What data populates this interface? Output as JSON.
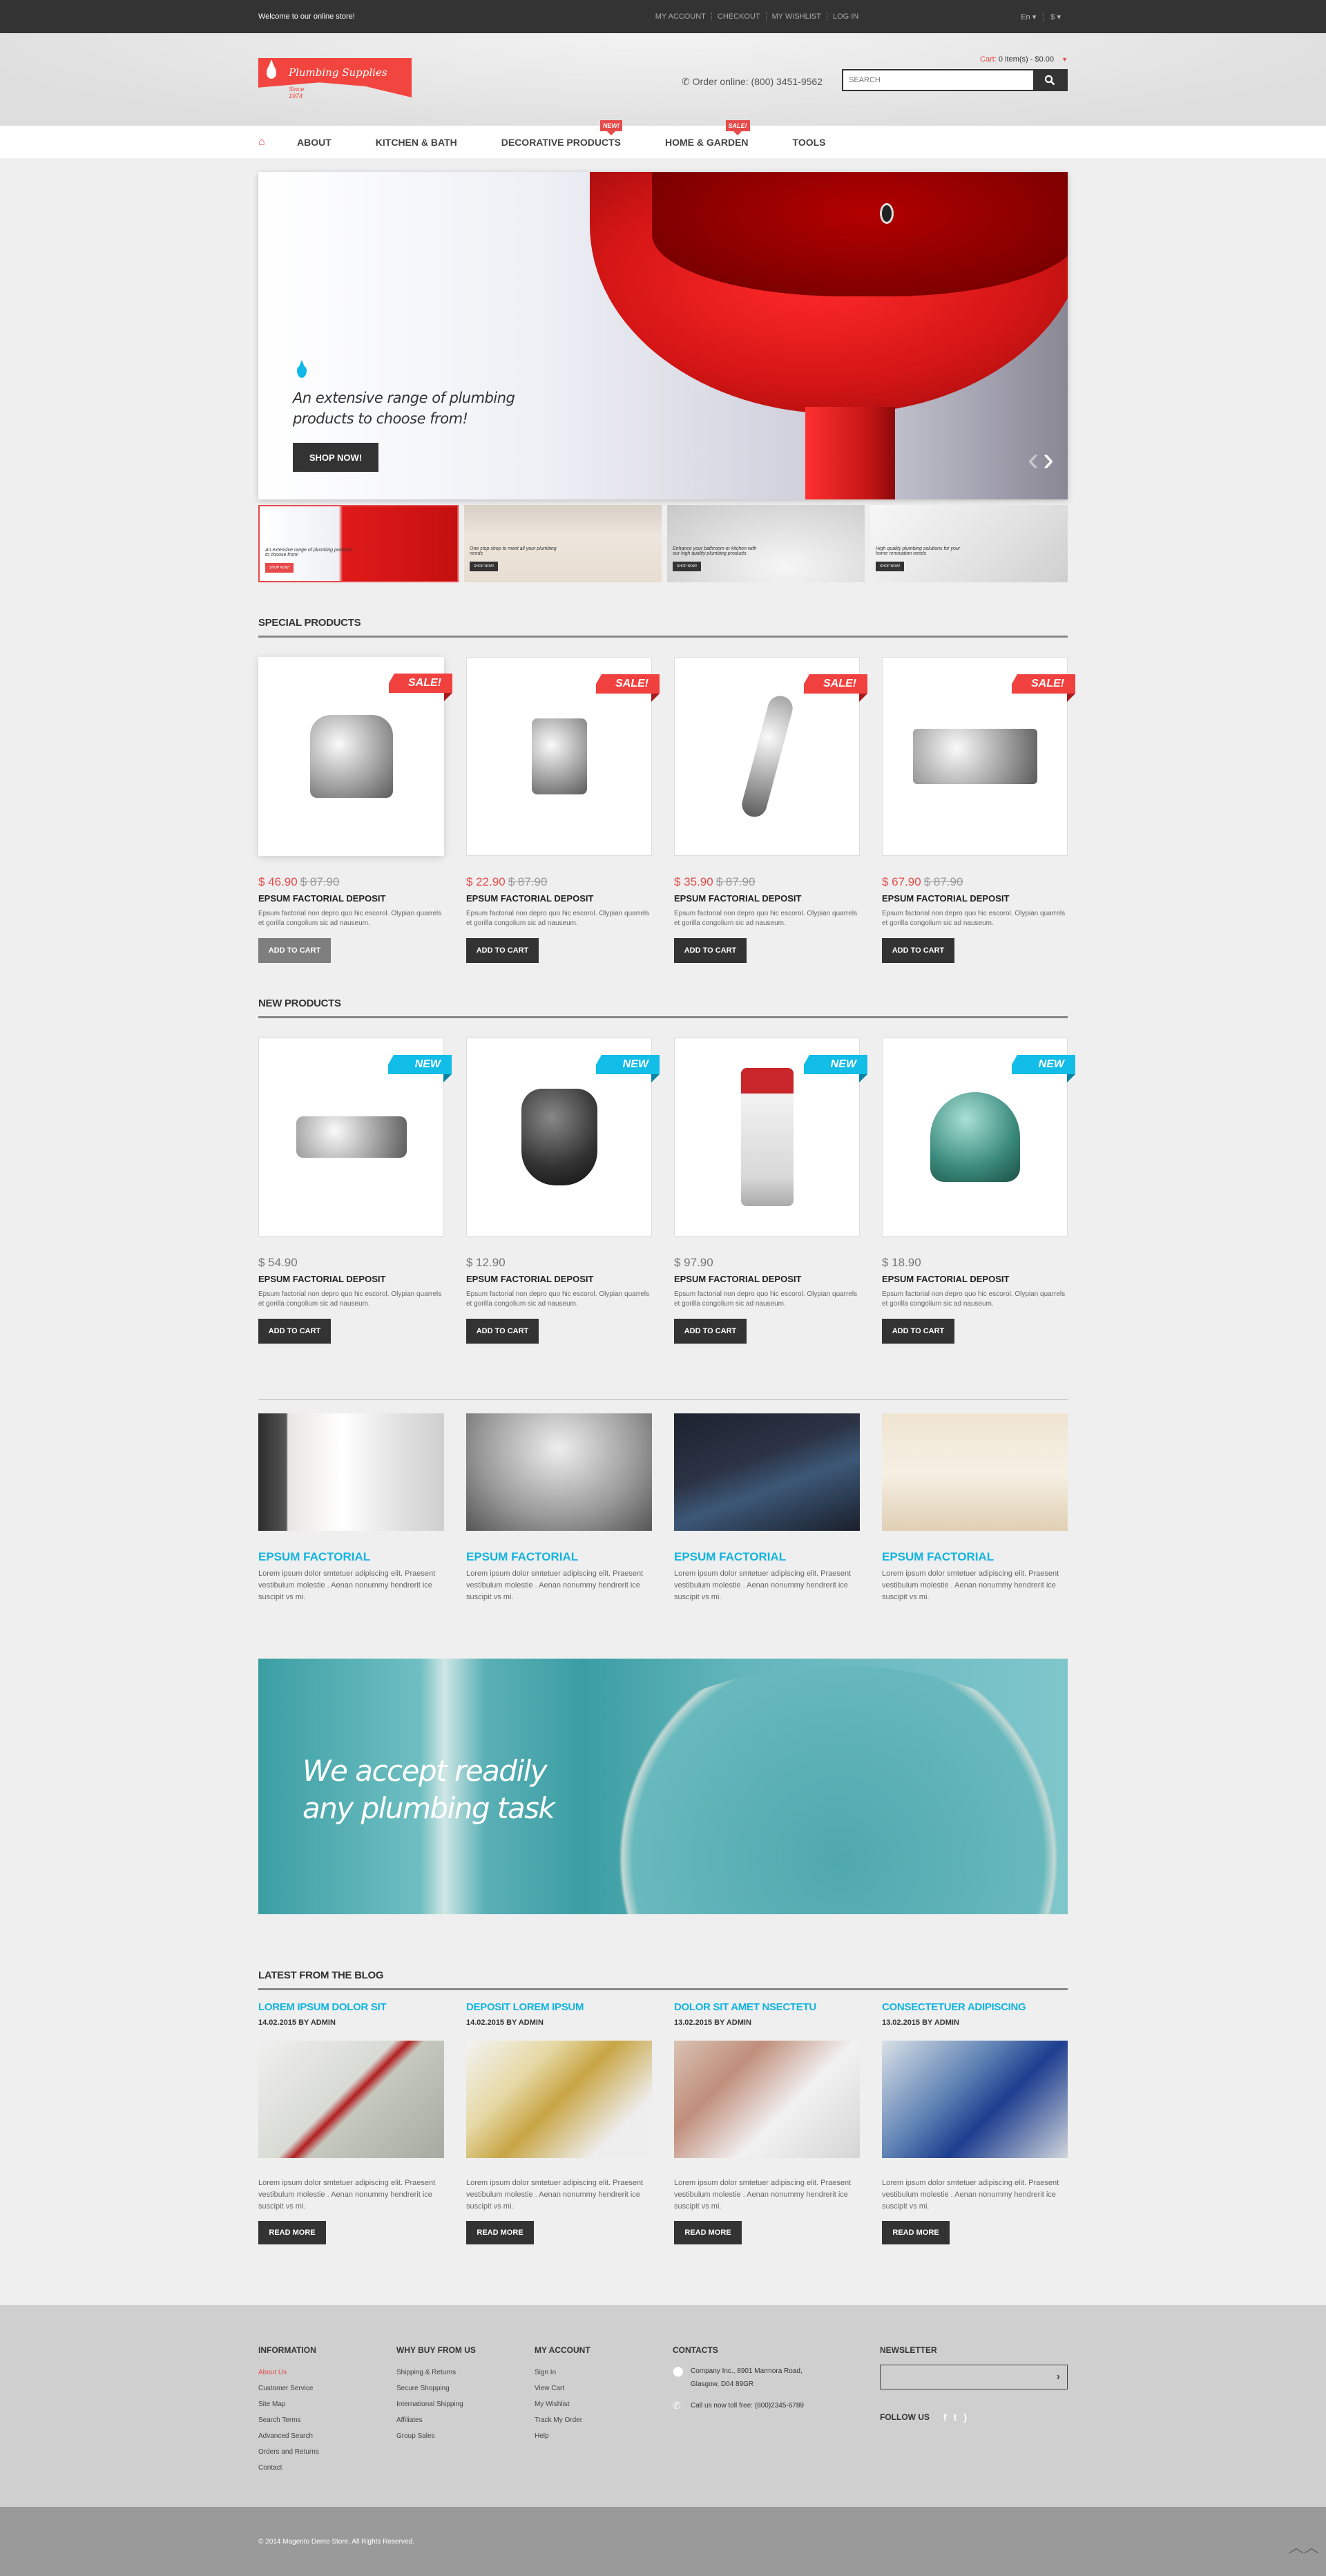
{
  "topbar": {
    "welcome": "Welcome to our online store!",
    "links": [
      "MY ACCOUNT",
      "CHECKOUT",
      "MY WISHLIST",
      "LOG IN"
    ],
    "language": "En",
    "currency": "$"
  },
  "header": {
    "logo_title": "Plumbing Supplies",
    "logo_since": "Since 1974",
    "cart_label": "Cart:",
    "cart_value": "0 item(s) - $0.00",
    "order_online": "Order online: (800) 3451-9562",
    "search_placeholder": "SEARCH"
  },
  "nav": {
    "items": [
      {
        "label": "ABOUT",
        "badge": ""
      },
      {
        "label": "KITCHEN & BATH",
        "badge": ""
      },
      {
        "label": "DECORATIVE PRODUCTS",
        "badge": "NEW!"
      },
      {
        "label": "HOME & GARDEN",
        "badge": "SALE!"
      },
      {
        "label": "TOOLS",
        "badge": ""
      }
    ]
  },
  "slider": {
    "caption": "An extensive range of plumbing products to choose from!",
    "button": "SHOP NOW!",
    "thumbs": [
      {
        "caption": "An extensive range of plumbing products to choose from!",
        "button": "SHOP NOW!"
      },
      {
        "caption": "One stop shop to meet all your plumbing needs",
        "button": "SHOP NOW!"
      },
      {
        "caption": "Enhance your bathroom or kitchen with our high quality plumbing products",
        "button": "SHOP NOW!"
      },
      {
        "caption": "High quality plumbing solutions for your home renovation needs",
        "button": "SHOP NOW!"
      }
    ]
  },
  "special": {
    "title": "SPECIAL PRODUCTS",
    "badge": "SALE!",
    "items": [
      {
        "price": "$ 46.90",
        "old_price": "$ 87.90",
        "name": "EPSUM FACTORIAL DEPOSIT",
        "desc": "Epsum factorial non depro quo hic escorol. Olypian quarrels et gorilla congolium sic ad nauseum.",
        "button": "ADD TO CART"
      },
      {
        "price": "$ 22.90",
        "old_price": "$ 87.90",
        "name": "EPSUM FACTORIAL DEPOSIT",
        "desc": "Epsum factorial non depro quo hic escorol. Olypian quarrels et gorilla congolium sic ad nauseum.",
        "button": "ADD TO CART"
      },
      {
        "price": "$ 35.90",
        "old_price": "$ 87.90",
        "name": "EPSUM FACTORIAL DEPOSIT",
        "desc": "Epsum factorial non depro quo hic escorol. Olypian quarrels et gorilla congolium sic ad nauseum.",
        "button": "ADD TO CART"
      },
      {
        "price": "$ 67.90",
        "old_price": "$ 87.90",
        "name": "EPSUM FACTORIAL DEPOSIT",
        "desc": "Epsum factorial non depro quo hic escorol. Olypian quarrels et gorilla congolium sic ad nauseum.",
        "button": "ADD TO CART"
      }
    ]
  },
  "new_products": {
    "title": "NEW PRODUCTS",
    "badge": "NEW",
    "items": [
      {
        "price": "$ 54.90",
        "name": "EPSUM FACTORIAL DEPOSIT",
        "desc": "Epsum factorial non depro quo hic escorol. Olypian quarrels et gorilla congolium sic ad nauseum.",
        "button": "ADD TO CART"
      },
      {
        "price": "$ 12.90",
        "name": "EPSUM FACTORIAL DEPOSIT",
        "desc": "Epsum factorial non depro quo hic escorol. Olypian quarrels et gorilla congolium sic ad nauseum.",
        "button": "ADD TO CART"
      },
      {
        "price": "$ 97.90",
        "name": "EPSUM FACTORIAL DEPOSIT",
        "desc": "Epsum factorial non depro quo hic escorol. Olypian quarrels et gorilla congolium sic ad nauseum.",
        "button": "ADD TO CART"
      },
      {
        "price": "$ 18.90",
        "name": "EPSUM FACTORIAL DEPOSIT",
        "desc": "Epsum factorial non depro quo hic escorol. Olypian quarrels et gorilla congolium sic ad nauseum.",
        "button": "ADD TO CART"
      }
    ]
  },
  "features": [
    {
      "title": "EPSUM FACTORIAL",
      "desc": "Lorem ipsum dolor smtetuer adipiscing elit. Praesent vestibulum molestie . Aenan nonummy hendrerit ice suscipit vs mi."
    },
    {
      "title": "EPSUM FACTORIAL",
      "desc": "Lorem ipsum dolor smtetuer adipiscing elit. Praesent vestibulum molestie . Aenan nonummy hendrerit ice suscipit vs mi."
    },
    {
      "title": "EPSUM FACTORIAL",
      "desc": "Lorem ipsum dolor smtetuer adipiscing elit. Praesent vestibulum molestie . Aenan nonummy hendrerit ice suscipit vs mi."
    },
    {
      "title": "EPSUM FACTORIAL",
      "desc": "Lorem ipsum dolor smtetuer adipiscing elit. Praesent vestibulum molestie . Aenan nonummy hendrerit ice suscipit vs mi."
    }
  ],
  "banner": {
    "line1": "We accept readily",
    "line2": "any plumbing task"
  },
  "blog": {
    "title": "LATEST FROM THE BLOG",
    "posts": [
      {
        "title": "LOREM IPSUM DOLOR SIT",
        "meta": "14.02.2015 BY ADMIN",
        "desc": "Lorem ipsum dolor smtetuer adipiscing elit. Praesent vestibulum molestie . Aenan nonummy hendrerit ice suscipit vs mi.",
        "button": "READ MORE"
      },
      {
        "title": "DEPOSIT LOREM IPSUM",
        "meta": "14.02.2015 BY ADMIN",
        "desc": "Lorem ipsum dolor smtetuer adipiscing elit. Praesent vestibulum molestie . Aenan nonummy hendrerit ice suscipit vs mi.",
        "button": "READ MORE"
      },
      {
        "title": "DOLOR SIT AMET NSECTETU",
        "meta": "13.02.2015 BY ADMIN",
        "desc": "Lorem ipsum dolor smtetuer adipiscing elit. Praesent vestibulum molestie . Aenan nonummy hendrerit ice suscipit vs mi.",
        "button": "READ MORE"
      },
      {
        "title": "CONSECTETUER ADIPISCING",
        "meta": "13.02.2015 BY ADMIN",
        "desc": "Lorem ipsum dolor smtetuer adipiscing elit. Praesent vestibulum molestie . Aenan nonummy hendrerit ice suscipit vs mi.",
        "button": "READ MORE"
      }
    ]
  },
  "footer": {
    "information": {
      "title": "INFORMATION",
      "links": [
        "About Us",
        "Customer Service",
        "Site Map",
        "Search Terms",
        "Advanced Search",
        "Orders and Returns",
        "Contact"
      ]
    },
    "why_buy": {
      "title": "WHY BUY FROM US",
      "links": [
        "Shipping & Returns",
        "Secure Shopping",
        "International Shipping",
        "Affiliates",
        "Group Sales"
      ]
    },
    "my_account": {
      "title": "MY ACCOUNT",
      "links": [
        "Sign In",
        "View Cart",
        "My Wishlist",
        "Track My Order",
        "Help"
      ]
    },
    "contacts": {
      "title": "CONTACTS",
      "address_line1": "Company Inc., 8901 Marmora Road,",
      "address_line2": "Glasgow, D04 89GR",
      "phone": "Call us now toll free: (800)2345-6789"
    },
    "newsletter": {
      "title": "NEWSLETTER",
      "placeholder": ""
    },
    "follow_us": "FOLLOW US",
    "copyright": "© 2014 Magento Demo Store. All Rights Reserved."
  },
  "colors": {
    "accent_red": "#e64a4a",
    "accent_blue": "#12b4e0",
    "dark": "#333333"
  }
}
